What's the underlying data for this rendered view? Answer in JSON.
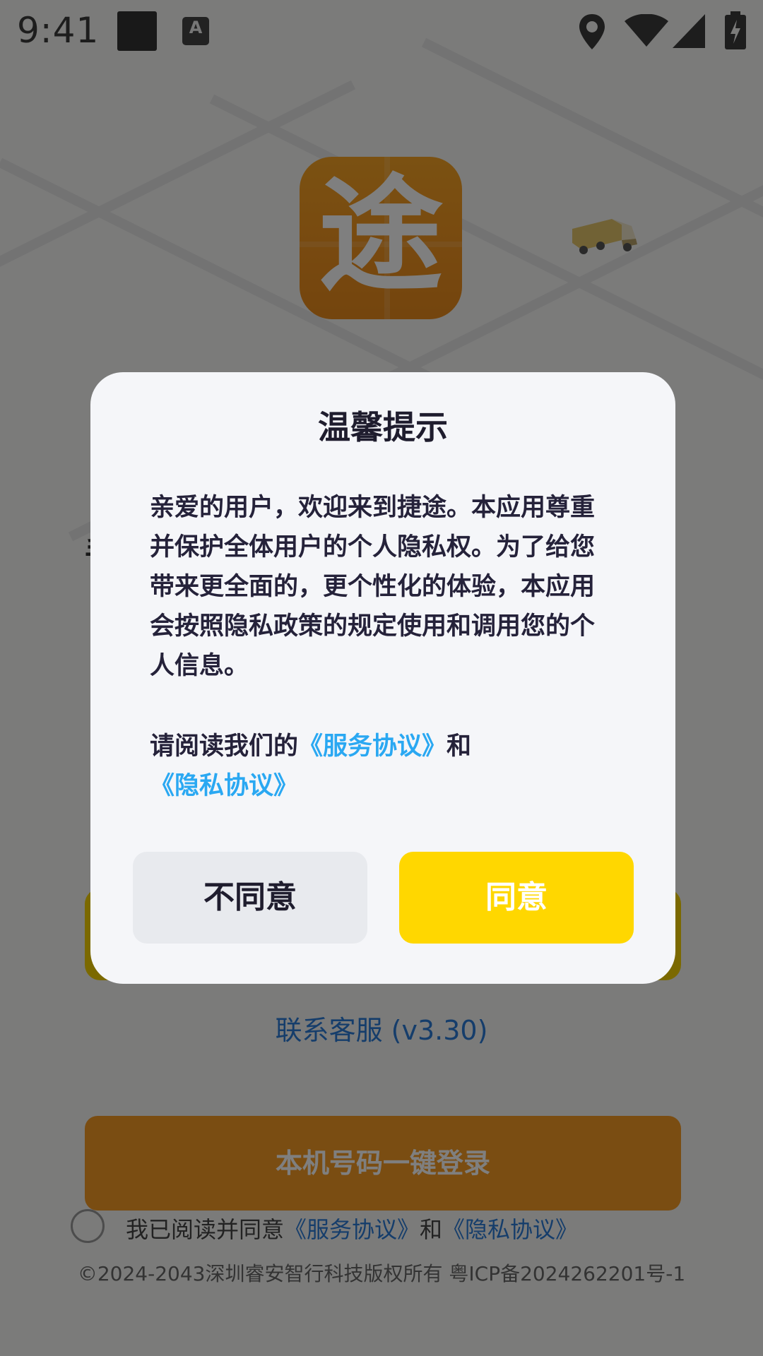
{
  "status_bar": {
    "time": "9:41",
    "left_icons": [
      "square-notification-icon",
      "text-input-icon"
    ],
    "right_icons": [
      "location-icon",
      "wifi-icon",
      "signal-icon",
      "battery-charging-icon"
    ]
  },
  "app": {
    "logo_char": "途",
    "logo_color": "#f59a25",
    "contact": "联系客服 (v3.30)",
    "login_button": "本机号码一键登录",
    "agree_prefix": "我已阅读并同意",
    "agree_link1": "《服务协议》",
    "agree_and": "和",
    "agree_link2": "《隐私协议》",
    "copyright": "©2024-2043深圳睿安智行科技版权所有 粤ICP备2024262201号-1"
  },
  "dialog": {
    "title": "温馨提示",
    "body": "亲爱的用户，欢迎来到捷途。本应用尊重并保护全体用户的个人隐私权。为了给您带来更全面的，更个性化的体验，本应用会按照隐私政策的规定使用和调用您的个人信息。",
    "links_prefix": "请阅读我们的",
    "service_link": "《服务协议》",
    "and_text": "和",
    "privacy_link": "《隐私协议》",
    "disagree_button": "不同意",
    "agree_button": "同意"
  },
  "colors": {
    "accent_yellow": "#ffd700",
    "link_blue": "#2aa8f2",
    "login_orange": "#f59a25"
  }
}
